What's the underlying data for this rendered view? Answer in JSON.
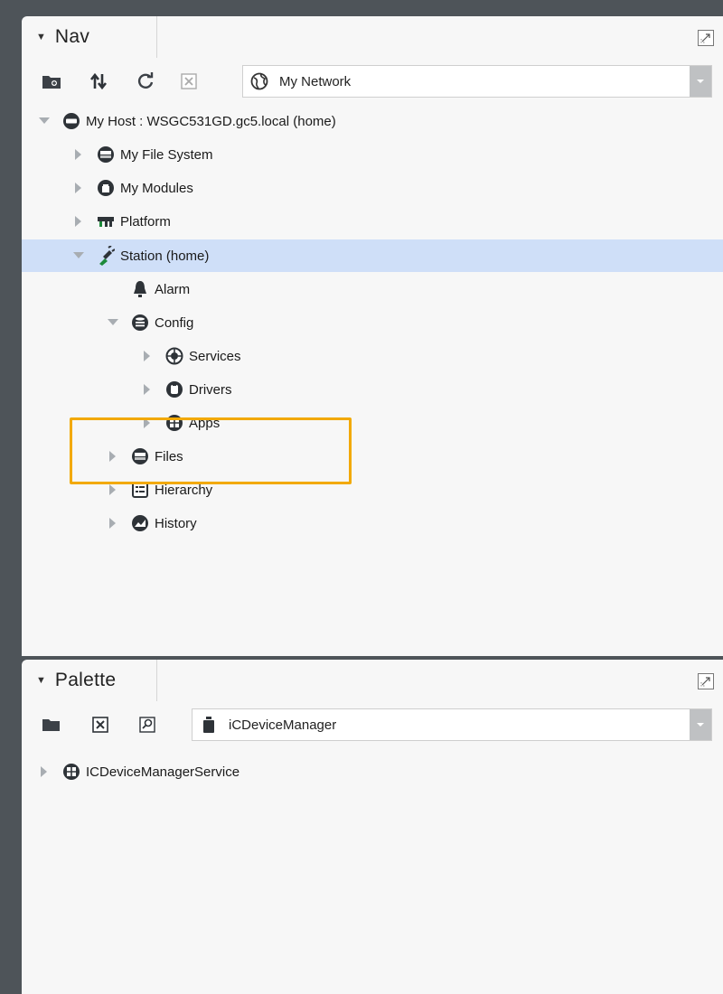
{
  "nav": {
    "title": "Nav",
    "toolbar": {
      "icons": [
        "new-folder-icon",
        "sort-icon",
        "refresh-icon",
        "close-tree-icon"
      ],
      "dropdown_value": "My Network",
      "dropdown_icon": "globe-icon"
    },
    "tree": {
      "host": "My Host : WSGC531GD.gc5.local (home)",
      "file_system": "My File System",
      "modules": "My Modules",
      "platform": "Platform",
      "station": "Station (home)",
      "alarm": "Alarm",
      "config": "Config",
      "services": "Services",
      "drivers": "Drivers",
      "apps": "Apps",
      "files": "Files",
      "hierarchy": "Hierarchy",
      "history": "History"
    },
    "selected_item": "Station (home)",
    "highlight_color": "#f2a900"
  },
  "palette": {
    "title": "Palette",
    "toolbar": {
      "icons": [
        "open-folder-icon",
        "close-icon",
        "find-icon"
      ],
      "dropdown_value": "iCDeviceManager",
      "dropdown_icon": "module-jar-icon"
    },
    "tree": {
      "item": "ICDeviceManagerService"
    }
  },
  "colors": {
    "selection": "#cfdff8",
    "background": "#f7f7f7",
    "frame": "#4e5459"
  }
}
